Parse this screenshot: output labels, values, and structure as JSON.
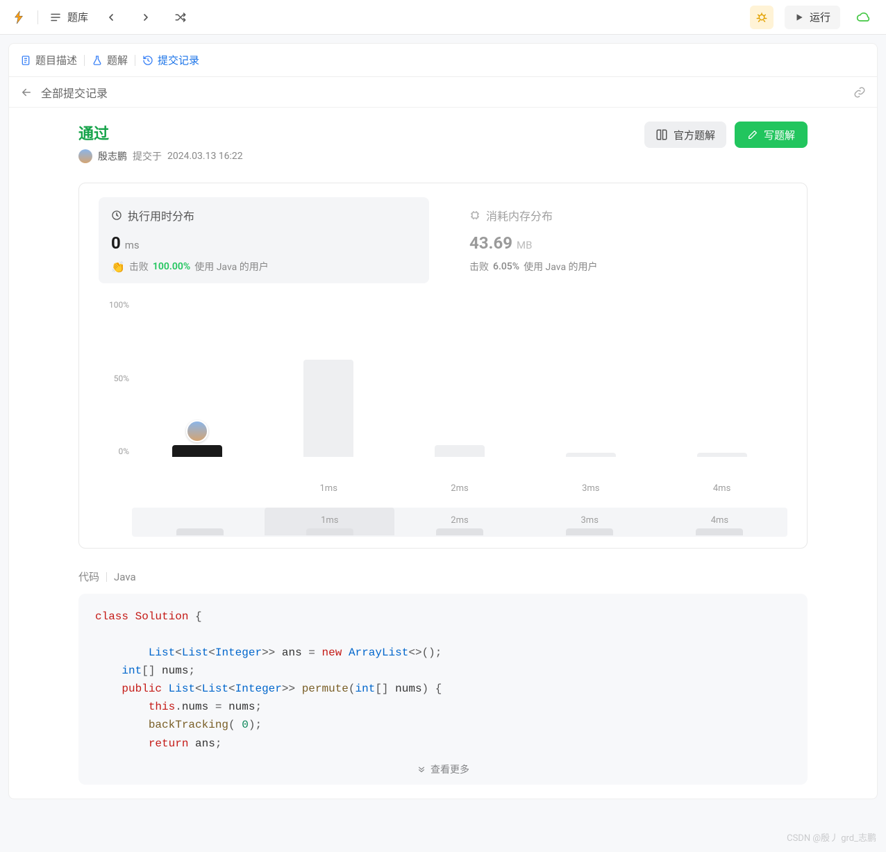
{
  "topbar": {
    "problem_list_label": "题库",
    "run_label": "运行"
  },
  "tabs": {
    "description": "题目描述",
    "solution": "题解",
    "submissions": "提交记录"
  },
  "subhead": {
    "all_submissions": "全部提交记录"
  },
  "submission": {
    "status": "通过",
    "username": "殷志鹏",
    "submitted_at_prefix": "提交于",
    "submitted_at": "2024.03.13 16:22",
    "official_solution_label": "官方题解",
    "write_solution_label": "写题解"
  },
  "stats": {
    "runtime": {
      "title": "执行用时分布",
      "value": "0",
      "unit": "ms",
      "beats_label": "击败",
      "beats_pct": "100.00%",
      "users_suffix": "使用 Java 的用户"
    },
    "memory": {
      "title": "消耗内存分布",
      "value": "43.69",
      "unit": "MB",
      "beats_label": "击败",
      "beats_pct": "6.05%",
      "users_suffix": "使用 Java 的用户"
    }
  },
  "chart_data": {
    "type": "bar",
    "ylabel_pct": true,
    "yticks": [
      "100%",
      "50%",
      "0%"
    ],
    "categories": [
      "",
      "1ms",
      "2ms",
      "3ms",
      "4ms"
    ],
    "values_pct": [
      8,
      65,
      8,
      3,
      3
    ],
    "user_bar_index": 0,
    "scrubber_categories": [
      "",
      "1ms",
      "2ms",
      "3ms",
      "4ms"
    ],
    "scrubber_highlight_index": 1
  },
  "code": {
    "label": "代码",
    "language": "Java",
    "show_more": "查看更多",
    "tokens": [
      [
        [
          "kw",
          "class"
        ],
        [
          "sp",
          " "
        ],
        [
          "cls",
          "Solution"
        ],
        [
          "sp",
          " "
        ],
        [
          "punc",
          "{"
        ]
      ],
      [],
      [
        [
          "indent",
          "        "
        ],
        [
          "type",
          "List"
        ],
        [
          "punc",
          "<"
        ],
        [
          "type",
          "List"
        ],
        [
          "punc",
          "<"
        ],
        [
          "type",
          "Integer"
        ],
        [
          "punc",
          ">>"
        ],
        [
          "sp",
          " "
        ],
        [
          "var",
          "ans"
        ],
        [
          "sp",
          " "
        ],
        [
          "punc",
          "="
        ],
        [
          "sp",
          " "
        ],
        [
          "new-kw",
          "new"
        ],
        [
          "sp",
          " "
        ],
        [
          "type",
          "ArrayList"
        ],
        [
          "punc",
          "<>();"
        ]
      ],
      [
        [
          "indent",
          "    "
        ],
        [
          "type",
          "int"
        ],
        [
          "punc",
          "[]"
        ],
        [
          "sp",
          " "
        ],
        [
          "var",
          "nums"
        ],
        [
          "punc",
          ";"
        ]
      ],
      [
        [
          "indent",
          "    "
        ],
        [
          "kw",
          "public"
        ],
        [
          "sp",
          " "
        ],
        [
          "type",
          "List"
        ],
        [
          "punc",
          "<"
        ],
        [
          "type",
          "List"
        ],
        [
          "punc",
          "<"
        ],
        [
          "type",
          "Integer"
        ],
        [
          "punc",
          ">>"
        ],
        [
          "sp",
          " "
        ],
        [
          "func",
          "permute"
        ],
        [
          "punc",
          "("
        ],
        [
          "type",
          "int"
        ],
        [
          "punc",
          "[]"
        ],
        [
          "sp",
          " "
        ],
        [
          "var",
          "nums"
        ],
        [
          "punc",
          ")"
        ],
        [
          "sp",
          " "
        ],
        [
          "punc",
          "{"
        ]
      ],
      [
        [
          "indent",
          "        "
        ],
        [
          "kw",
          "this"
        ],
        [
          "punc",
          "."
        ],
        [
          "var",
          "nums"
        ],
        [
          "sp",
          " "
        ],
        [
          "punc",
          "="
        ],
        [
          "sp",
          " "
        ],
        [
          "var",
          "nums"
        ],
        [
          "punc",
          ";"
        ]
      ],
      [
        [
          "indent",
          "        "
        ],
        [
          "func",
          "backTracking"
        ],
        [
          "punc",
          "( "
        ],
        [
          "num",
          "0"
        ],
        [
          "punc",
          ");"
        ]
      ],
      [
        [
          "indent",
          "        "
        ],
        [
          "kw",
          "return"
        ],
        [
          "sp",
          " "
        ],
        [
          "var",
          "ans"
        ],
        [
          "punc",
          ";"
        ]
      ]
    ]
  },
  "watermark": "CSDN @殷丿 grd_志鹏"
}
